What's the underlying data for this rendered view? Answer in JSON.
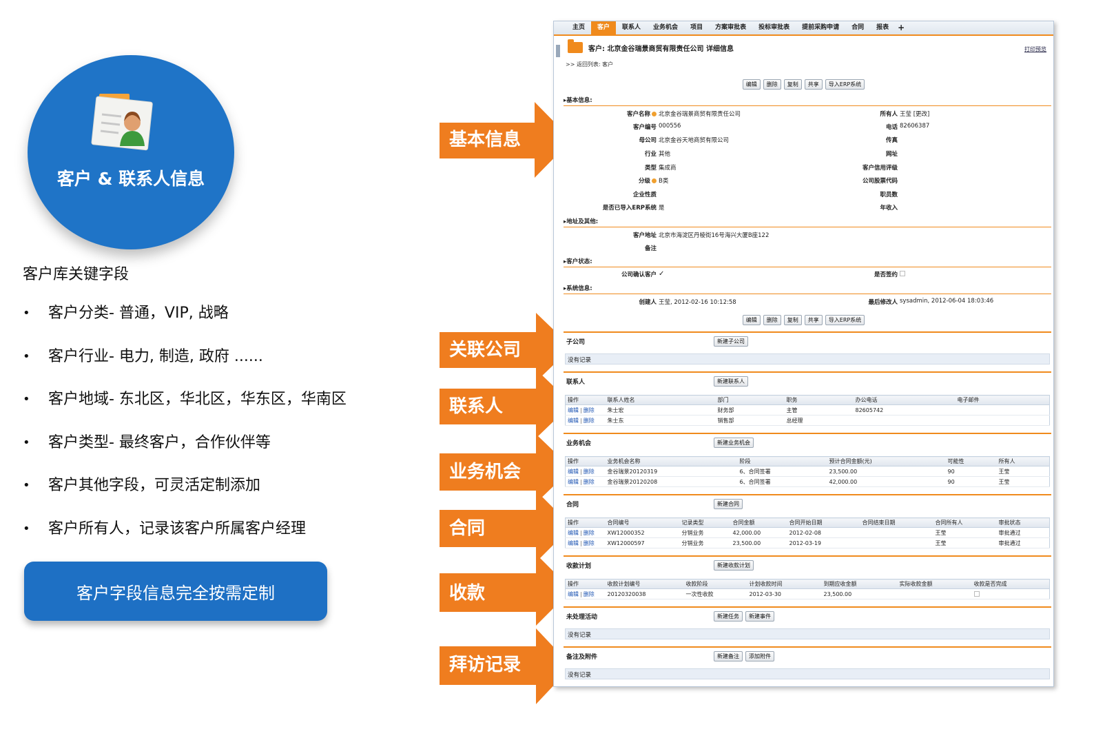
{
  "left": {
    "circle_title": "客户 & 联系人信息",
    "heading": "客户库关键字段",
    "bullets": [
      "客户分类- 普通，VIP, 战略",
      "客户行业- 电力, 制造, 政府 ......",
      "客户地域-  东北区，华北区，华东区，华南区",
      "客户类型- 最终客户，合作伙伴等",
      "客户其他字段，可灵活定制添加",
      "客户所有人，记录该客户所属客户经理"
    ],
    "bullet_symbol": "•",
    "custom_button": "客户字段信息完全按需定制"
  },
  "callouts": [
    "基本信息",
    "关联公司",
    "联系人",
    "业务机会",
    "合同",
    "收款",
    "拜访记录"
  ],
  "crm": {
    "nav": [
      "主页",
      "客户",
      "联系人",
      "业务机会",
      "项目",
      "方案审批表",
      "投标审批表",
      "提前采购申请",
      "合同",
      "报表"
    ],
    "nav_active": "客户",
    "nav_plus": "+",
    "title": "客户: 北京金谷瑞景商贸有限责任公司 详细信息",
    "print": "打印预览",
    "back": ">> 返回列表: 客户",
    "actions": [
      "编辑",
      "删除",
      "复制",
      "共享",
      "导入ERP系统"
    ],
    "sections": {
      "basic": "▸基本信息:",
      "address": "▸地址及其他:",
      "status": "▸客户状态:",
      "system": "▸系统信息:"
    },
    "basic": {
      "customer_name_label": "客户名称",
      "customer_name": "北京金谷瑞景商贸有限责任公司",
      "owner_label": "所有人",
      "owner": "王莹 [更改]",
      "customer_no_label": "客户编号",
      "customer_no": "000556",
      "phone_label": "电话",
      "phone": "82606387",
      "parent_label": "母公司",
      "parent": "北京金谷天地商贸有限公司",
      "fax_label": "传真",
      "industry_label": "行业",
      "industry": "其他",
      "website_label": "网址",
      "type_label": "类型",
      "type": "集成商",
      "credit_label": "客户信用评级",
      "grade_label": "分级",
      "grade": "B类",
      "stock_label": "公司股票代码",
      "nature_label": "企业性质",
      "staff_label": "职员数",
      "erp_label": "是否已导入ERP系统",
      "erp": "是",
      "revenue_label": "年收入"
    },
    "address": {
      "addr_label": "客户地址",
      "addr": "北京市海淀区丹棱街16号海兴大厦B座122",
      "remark_label": "备注"
    },
    "status": {
      "confirm_label": "公司确认客户",
      "confirm": "✓",
      "signed_label": "是否签约"
    },
    "system": {
      "creator_label": "创建人",
      "creator": "王莹, 2012-02-16 10:12:58",
      "modifier_label": "最后修改人",
      "modifier": "sysadmin, 2012-06-04 18:03:46"
    },
    "subsidiary": {
      "title": "子公司",
      "btn": "新建子公司",
      "empty": "没有记录"
    },
    "contacts": {
      "title": "联系人",
      "btn": "新建联系人",
      "headers": [
        "操作",
        "联系人姓名",
        "部门",
        "职务",
        "办公电话",
        "电子邮件"
      ],
      "rows": [
        [
          "朱士宏",
          "财务部",
          "主管",
          "82605742",
          ""
        ],
        [
          "朱士东",
          "销售部",
          "总经理",
          "",
          ""
        ]
      ]
    },
    "opportunities": {
      "title": "业务机会",
      "btn": "新建业务机会",
      "headers": [
        "操作",
        "业务机会名称",
        "阶段",
        "预计合同金额(元)",
        "可能性",
        "所有人"
      ],
      "rows": [
        [
          "金谷瑞景20120319",
          "6、合同签署",
          "23,500.00",
          "90",
          "王莹"
        ],
        [
          "金谷瑞景20120208",
          "6、合同签署",
          "42,000.00",
          "90",
          "王莹"
        ]
      ]
    },
    "contracts": {
      "title": "合同",
      "btn": "新建合同",
      "headers": [
        "操作",
        "合同编号",
        "记录类型",
        "合同金额",
        "合同开始日期",
        "合同结束日期",
        "合同所有人",
        "审批状态"
      ],
      "rows": [
        [
          "XW12000352",
          "分销业务",
          "42,000.00",
          "2012-02-08",
          "",
          "王莹",
          "审批通过"
        ],
        [
          "XW12000597",
          "分销业务",
          "23,500.00",
          "2012-03-19",
          "",
          "王莹",
          "审批通过"
        ]
      ]
    },
    "payments": {
      "title": "收款计划",
      "btn": "新建收款计划",
      "headers": [
        "操作",
        "收款计划编号",
        "收款阶段",
        "计划收款时间",
        "到期应收金额",
        "实际收款金额",
        "收款是否完成"
      ],
      "rows": [
        [
          "20120320038",
          "一次性收款",
          "2012-03-30",
          "23,500.00",
          "",
          ""
        ]
      ]
    },
    "activities": {
      "title": "未处理活动",
      "btns": [
        "新建任务",
        "新建事件"
      ],
      "empty": "没有记录"
    },
    "notes": {
      "title": "备注及附件",
      "btns": [
        "新建备注",
        "添加附件"
      ],
      "empty": "没有记录"
    },
    "op_edit": "编辑",
    "op_delete": "删除",
    "op_sep": "|"
  },
  "colors": {
    "blue": "#1f74c7",
    "orange": "#f08a1c",
    "link": "#1f56b3"
  }
}
